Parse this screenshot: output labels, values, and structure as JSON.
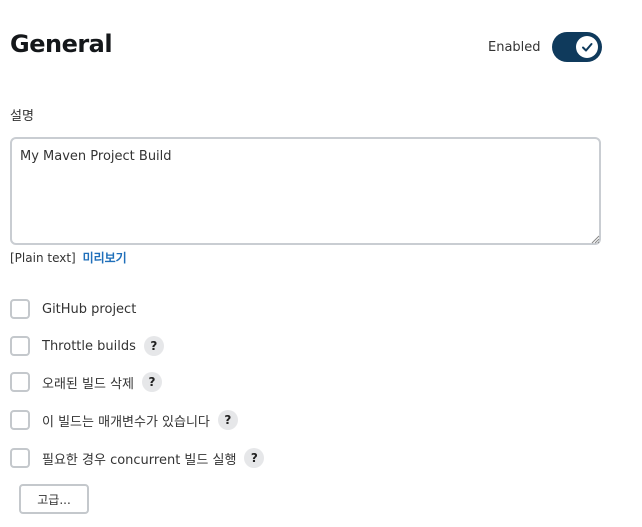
{
  "section": {
    "title": "General",
    "enabled_label": "Enabled",
    "enabled": true
  },
  "description": {
    "label": "설명",
    "value": "My Maven Project Build",
    "format": "[Plain text]",
    "preview_link": "미리보기"
  },
  "options": [
    {
      "label": "GitHub project",
      "checked": false,
      "has_help": false
    },
    {
      "label": "Throttle builds",
      "checked": false,
      "has_help": true,
      "help": "?"
    },
    {
      "label": "오래된 빌드 삭제",
      "checked": false,
      "has_help": true,
      "help": "?"
    },
    {
      "label": "이 빌드는 매개변수가 있습니다",
      "checked": false,
      "has_help": true,
      "help": "?"
    },
    {
      "label": "필요한 경우 concurrent 빌드 실행",
      "checked": false,
      "has_help": true,
      "help": "?"
    }
  ],
  "advanced_button": "고급...",
  "colors": {
    "toggle_on": "#0f3a5c",
    "link": "#1f6fba",
    "border": "#c4c8cc"
  },
  "icons": {
    "toggle_check": "check-icon",
    "help": "help-icon",
    "resize": "resize-grip-icon"
  }
}
